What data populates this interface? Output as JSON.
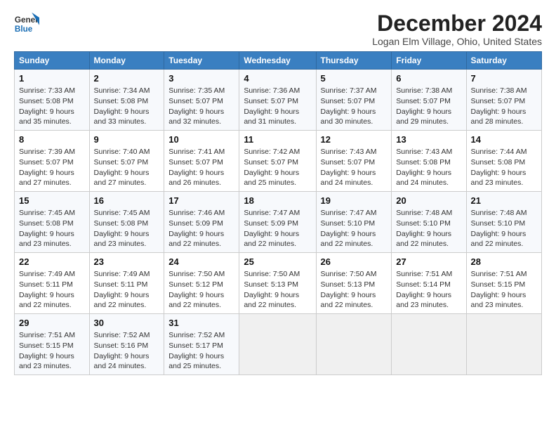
{
  "header": {
    "logo_general": "General",
    "logo_blue": "Blue",
    "month_title": "December 2024",
    "location": "Logan Elm Village, Ohio, United States"
  },
  "days_of_week": [
    "Sunday",
    "Monday",
    "Tuesday",
    "Wednesday",
    "Thursday",
    "Friday",
    "Saturday"
  ],
  "weeks": [
    [
      {
        "day": 1,
        "sunrise": "7:33 AM",
        "sunset": "5:08 PM",
        "daylight": "9 hours and 35 minutes."
      },
      {
        "day": 2,
        "sunrise": "7:34 AM",
        "sunset": "5:08 PM",
        "daylight": "9 hours and 33 minutes."
      },
      {
        "day": 3,
        "sunrise": "7:35 AM",
        "sunset": "5:07 PM",
        "daylight": "9 hours and 32 minutes."
      },
      {
        "day": 4,
        "sunrise": "7:36 AM",
        "sunset": "5:07 PM",
        "daylight": "9 hours and 31 minutes."
      },
      {
        "day": 5,
        "sunrise": "7:37 AM",
        "sunset": "5:07 PM",
        "daylight": "9 hours and 30 minutes."
      },
      {
        "day": 6,
        "sunrise": "7:38 AM",
        "sunset": "5:07 PM",
        "daylight": "9 hours and 29 minutes."
      },
      {
        "day": 7,
        "sunrise": "7:38 AM",
        "sunset": "5:07 PM",
        "daylight": "9 hours and 28 minutes."
      }
    ],
    [
      {
        "day": 8,
        "sunrise": "7:39 AM",
        "sunset": "5:07 PM",
        "daylight": "9 hours and 27 minutes."
      },
      {
        "day": 9,
        "sunrise": "7:40 AM",
        "sunset": "5:07 PM",
        "daylight": "9 hours and 27 minutes."
      },
      {
        "day": 10,
        "sunrise": "7:41 AM",
        "sunset": "5:07 PM",
        "daylight": "9 hours and 26 minutes."
      },
      {
        "day": 11,
        "sunrise": "7:42 AM",
        "sunset": "5:07 PM",
        "daylight": "9 hours and 25 minutes."
      },
      {
        "day": 12,
        "sunrise": "7:43 AM",
        "sunset": "5:07 PM",
        "daylight": "9 hours and 24 minutes."
      },
      {
        "day": 13,
        "sunrise": "7:43 AM",
        "sunset": "5:08 PM",
        "daylight": "9 hours and 24 minutes."
      },
      {
        "day": 14,
        "sunrise": "7:44 AM",
        "sunset": "5:08 PM",
        "daylight": "9 hours and 23 minutes."
      }
    ],
    [
      {
        "day": 15,
        "sunrise": "7:45 AM",
        "sunset": "5:08 PM",
        "daylight": "9 hours and 23 minutes."
      },
      {
        "day": 16,
        "sunrise": "7:45 AM",
        "sunset": "5:08 PM",
        "daylight": "9 hours and 23 minutes."
      },
      {
        "day": 17,
        "sunrise": "7:46 AM",
        "sunset": "5:09 PM",
        "daylight": "9 hours and 22 minutes."
      },
      {
        "day": 18,
        "sunrise": "7:47 AM",
        "sunset": "5:09 PM",
        "daylight": "9 hours and 22 minutes."
      },
      {
        "day": 19,
        "sunrise": "7:47 AM",
        "sunset": "5:10 PM",
        "daylight": "9 hours and 22 minutes."
      },
      {
        "day": 20,
        "sunrise": "7:48 AM",
        "sunset": "5:10 PM",
        "daylight": "9 hours and 22 minutes."
      },
      {
        "day": 21,
        "sunrise": "7:48 AM",
        "sunset": "5:10 PM",
        "daylight": "9 hours and 22 minutes."
      }
    ],
    [
      {
        "day": 22,
        "sunrise": "7:49 AM",
        "sunset": "5:11 PM",
        "daylight": "9 hours and 22 minutes."
      },
      {
        "day": 23,
        "sunrise": "7:49 AM",
        "sunset": "5:11 PM",
        "daylight": "9 hours and 22 minutes."
      },
      {
        "day": 24,
        "sunrise": "7:50 AM",
        "sunset": "5:12 PM",
        "daylight": "9 hours and 22 minutes."
      },
      {
        "day": 25,
        "sunrise": "7:50 AM",
        "sunset": "5:13 PM",
        "daylight": "9 hours and 22 minutes."
      },
      {
        "day": 26,
        "sunrise": "7:50 AM",
        "sunset": "5:13 PM",
        "daylight": "9 hours and 22 minutes."
      },
      {
        "day": 27,
        "sunrise": "7:51 AM",
        "sunset": "5:14 PM",
        "daylight": "9 hours and 23 minutes."
      },
      {
        "day": 28,
        "sunrise": "7:51 AM",
        "sunset": "5:15 PM",
        "daylight": "9 hours and 23 minutes."
      }
    ],
    [
      {
        "day": 29,
        "sunrise": "7:51 AM",
        "sunset": "5:15 PM",
        "daylight": "9 hours and 23 minutes."
      },
      {
        "day": 30,
        "sunrise": "7:52 AM",
        "sunset": "5:16 PM",
        "daylight": "9 hours and 24 minutes."
      },
      {
        "day": 31,
        "sunrise": "7:52 AM",
        "sunset": "5:17 PM",
        "daylight": "9 hours and 25 minutes."
      },
      null,
      null,
      null,
      null
    ]
  ],
  "labels": {
    "sunrise": "Sunrise:",
    "sunset": "Sunset:",
    "daylight": "Daylight hours"
  }
}
